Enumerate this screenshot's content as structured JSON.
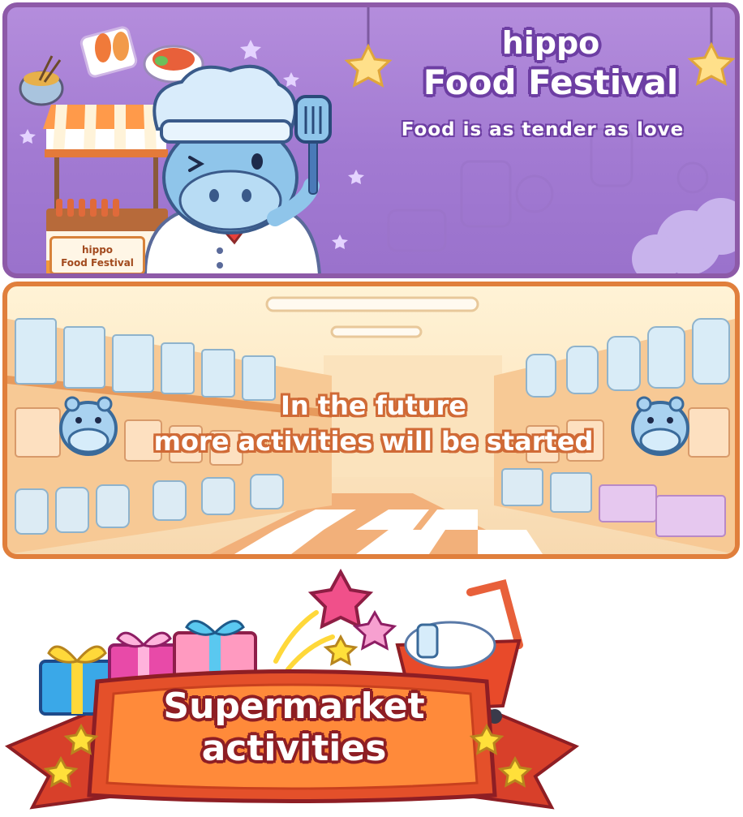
{
  "festival_banner": {
    "title_top": "hippo",
    "title_main": "Food Festival",
    "subtitle": "Food is as tender as love",
    "stall_sign_line1": "hippo",
    "stall_sign_line2": "Food Festival",
    "colors": {
      "border": "#8d5aa8",
      "background": "#a27ad2",
      "text_outline": "#6d3ea3"
    }
  },
  "future_banner": {
    "line1": "In the future",
    "line2": "more activities will be started",
    "colors": {
      "border": "#e07f3c",
      "background": "#fde8c4",
      "text_outline": "#d06a36"
    }
  },
  "activities_badge": {
    "title_line1": "Supermarket",
    "title_line2": "activities",
    "colors": {
      "ribbon": "#e4502a",
      "plaque": "#ff8a3a",
      "text_outline": "#8e1e24"
    }
  },
  "icons": [
    "hippo-chef-icon",
    "food-stall-icon",
    "spatula-icon",
    "hippo-face-icon",
    "gift-box-icon",
    "shopping-cart-icon",
    "star-icon"
  ]
}
